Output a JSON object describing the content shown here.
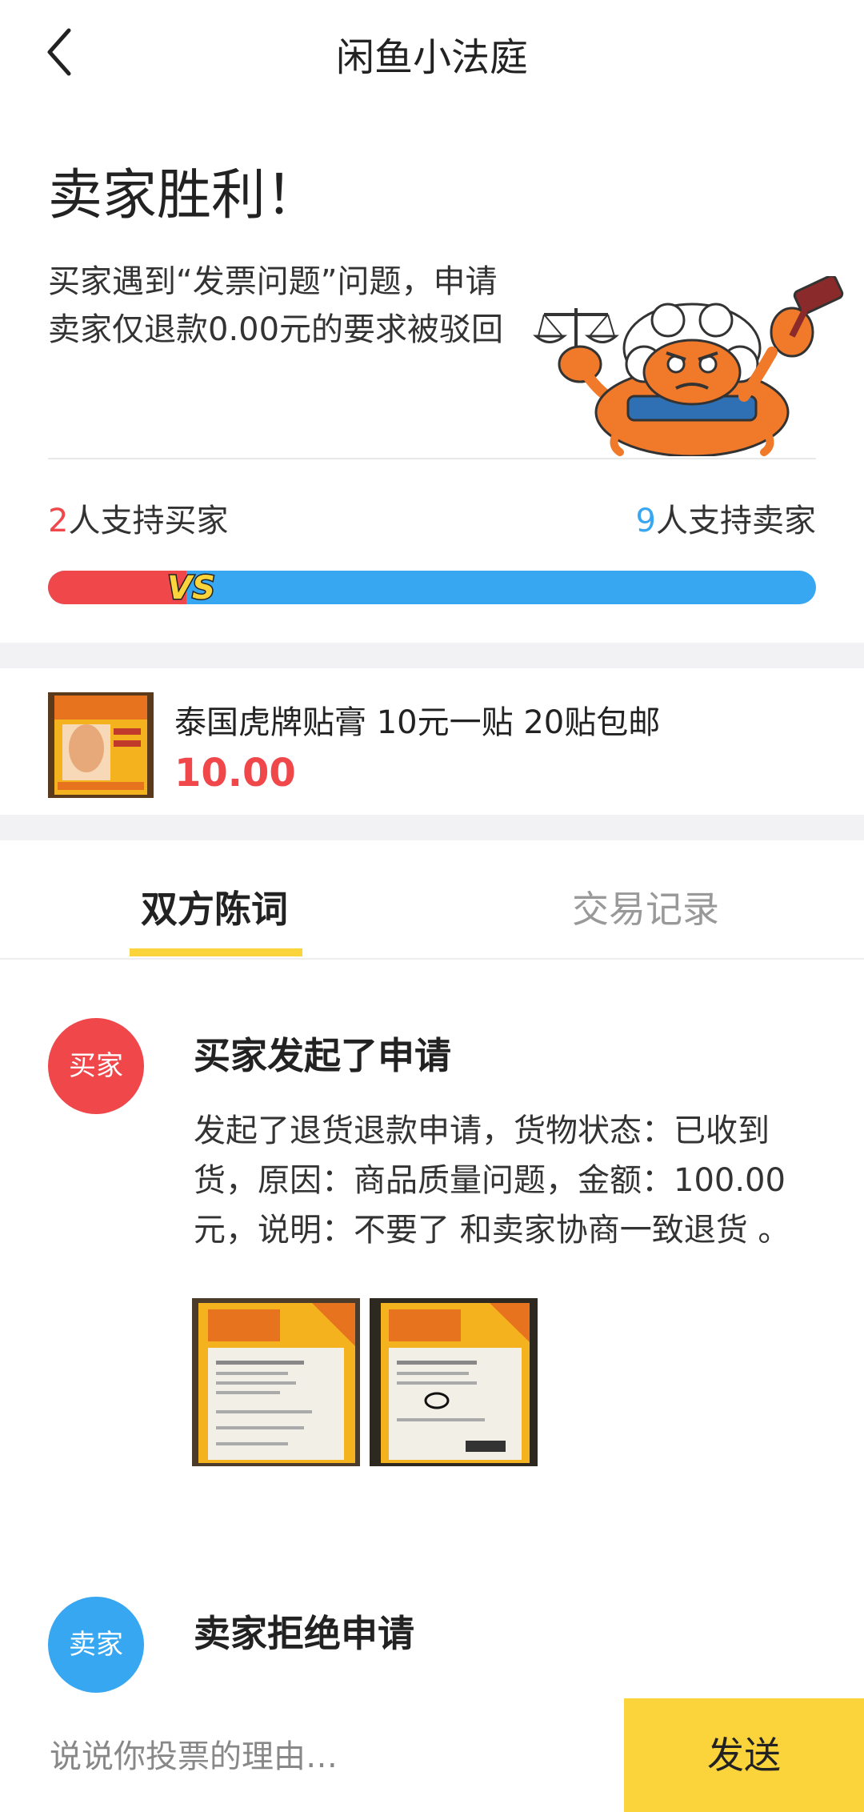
{
  "header": {
    "title": "闲鱼小法庭",
    "back_icon": "chevron-left-icon"
  },
  "verdict": {
    "title": "卖家胜利！",
    "description": "买家遇到“发票问题”问题，申请卖家仅退款0.00元的要求被驳回"
  },
  "votes": {
    "buyer_count": "2",
    "buyer_label": "人支持买家",
    "seller_count": "9",
    "seller_label": "人支持卖家",
    "buyer_share": 0.18,
    "vs_label": "VS"
  },
  "product": {
    "name": "泰国虎牌贴膏 10元一贴 20贴包邮",
    "price": "10.00"
  },
  "tabs": [
    {
      "label": "双方陈词",
      "active": true
    },
    {
      "label": "交易记录",
      "active": false
    }
  ],
  "timeline": [
    {
      "avatar": "买家",
      "title": "买家发起了申请",
      "body": "发起了退货退款申请，货物状态：已收到货，原因：商品质量问题，金额：100.00元，说明：不要了 和卖家协商一致退货 。"
    },
    {
      "avatar": "卖家",
      "title": "卖家拒绝申请"
    }
  ],
  "evidence_images": [
    "medicated-plaster-package-photo",
    "medicated-plaster-package-photo"
  ],
  "composer": {
    "placeholder": "说说你投票的理由…",
    "send_label": "发送"
  },
  "colors": {
    "buyer_red": "#f0474b",
    "seller_blue": "#38a7f2",
    "accent_yellow": "#fbd33b"
  }
}
